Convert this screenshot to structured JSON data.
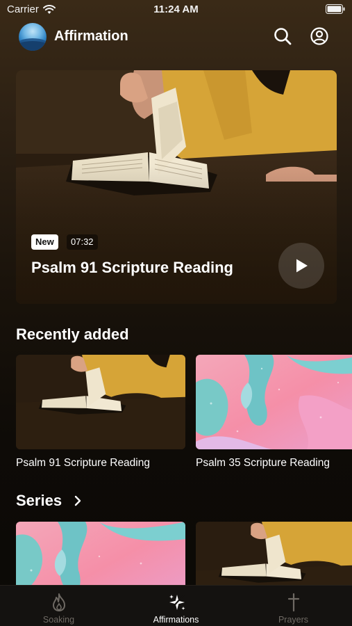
{
  "status_bar": {
    "carrier": "Carrier",
    "time": "11:24 AM"
  },
  "header": {
    "title": "Affirmation",
    "icons": [
      "search-icon",
      "profile-icon"
    ]
  },
  "hero": {
    "badge": "New",
    "duration": "07:32",
    "title": "Psalm 91 Scripture Reading",
    "image": "bible-reading-photo"
  },
  "recently_added": {
    "title": "Recently added",
    "items": [
      {
        "label": "Psalm 91 Scripture Reading",
        "image": "bible-reading-photo"
      },
      {
        "label": "Psalm 35 Scripture Reading",
        "image": "pink-fluid-art"
      }
    ]
  },
  "series": {
    "title": "Series",
    "items": [
      {
        "image": "pink-fluid-art"
      },
      {
        "image": "bible-reading-photo"
      }
    ]
  },
  "tab_bar": {
    "tabs": [
      {
        "label": "Soaking",
        "icon": "flame-icon",
        "active": false
      },
      {
        "label": "Affirmations",
        "icon": "sparkle-icon",
        "active": true
      },
      {
        "label": "Prayers",
        "icon": "cross-icon",
        "active": false
      }
    ]
  },
  "colors": {
    "background": "#0d0a07",
    "accent_text": "#ffffff",
    "inactive_tab": "#6f6a64"
  }
}
